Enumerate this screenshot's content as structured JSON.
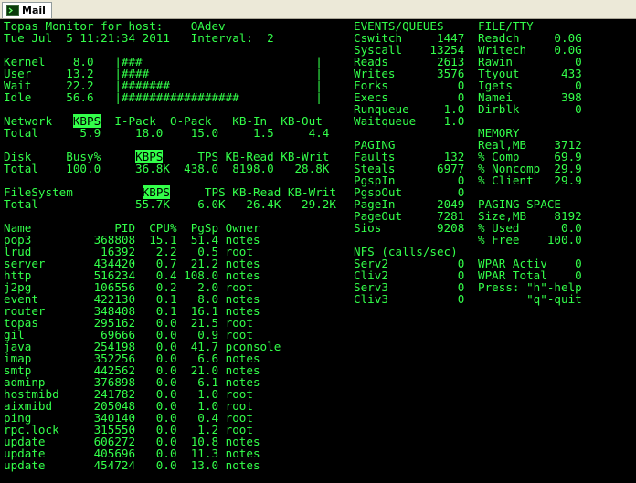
{
  "tab": {
    "label": "Mail"
  },
  "colors": {
    "background": "#000000",
    "foreground": "#33ff4a",
    "highlight_bg": "#33ff4a",
    "highlight_fg": "#000000"
  },
  "header": {
    "line1": "Topas Monitor for host:    OAdev",
    "line2": "Tue Jul  5 11:21:34 2011   Interval:  2"
  },
  "cpu": [
    "Kernel    8.0   |###                         |",
    "User     13.2   |####                        |",
    "Wait     22.2   |#######                     |",
    "Idle     56.6   |#################           |"
  ],
  "network": {
    "label": "Network",
    "kbps": "KBPS",
    "cols": "  I-Pack  O-Pack   KB-In  KB-Out",
    "total": "Total      5.9     18.0    15.0     1.5     4.4"
  },
  "disk": {
    "label": "Disk     Busy%     ",
    "kbps": "KBPS",
    "cols": "     TPS KB-Read KB-Writ",
    "total": "Total    100.0     36.8K  438.0  8198.0   28.8K"
  },
  "filesystem": {
    "label": "FileSystem          ",
    "kbps": "KBPS",
    "cols": "     TPS KB-Read KB-Writ",
    "total": "Total              55.7K    6.0K   26.4K   29.2K"
  },
  "process_header": "Name            PID  CPU%  PgSp Owner",
  "processes": [
    "pop3         368808  15.1  51.4 notes",
    "lrud          16392   2.2   0.5 root",
    "server       434420   0.7  21.2 notes",
    "http         516234   0.4 108.0 notes",
    "j2pg         106556   0.2   2.0 root",
    "event        422130   0.1   8.0 notes",
    "router       348408   0.1  16.1 notes",
    "topas        295162   0.0  21.5 root",
    "gil           69666   0.0   0.9 root",
    "java         254198   0.0  41.7 pconsole",
    "imap         352256   0.0   6.6 notes",
    "smtp         442562   0.0  21.0 notes",
    "adminp       376898   0.0   6.1 notes",
    "hostmibd     241782   0.0   1.0 root",
    "aixmibd      205048   0.0   1.0 root",
    "ping         340140   0.0   0.4 root",
    "rpc.lock     315550   0.0   1.2 root",
    "update       606272   0.0  10.8 notes",
    "update       405696   0.0  11.3 notes",
    "update       454724   0.0  13.0 notes"
  ],
  "events": [
    "EVENTS/QUEUES",
    "Cswitch     1447",
    "Syscall    13254",
    "Reads       2613",
    "Writes      3576",
    "Forks          0",
    "Execs          0",
    "Runqueue     1.0",
    "Waitqueue    1.0"
  ],
  "paging": [
    "PAGING",
    "Faults       132",
    "Steals      6977",
    "PgspIn         0",
    "PgspOut        0",
    "PageIn      2049",
    "PageOut     7281",
    "Sios        9208"
  ],
  "nfs": [
    "NFS (calls/sec)",
    "Serv2          0",
    "Cliv2          0",
    "Serv3          0",
    "Cliv3          0"
  ],
  "filetty": [
    "FILE/TTY",
    "Readch     0.0G",
    "Writech    0.0G",
    "Rawin         0",
    "Ttyout      433",
    "Igets         0",
    "Namei       398",
    "Dirblk        0"
  ],
  "memory": [
    "MEMORY",
    "Real,MB    3712",
    "% Comp     69.9",
    "% Noncomp  29.9",
    "% Client   29.9"
  ],
  "paging_space": [
    "PAGING SPACE",
    "Size,MB    8192",
    "% Used      0.0",
    "% Free    100.0"
  ],
  "wpar": [
    "WPAR Activ    0",
    "WPAR Total    0",
    "Press: \"h\"-help",
    "       \"q\"-quit"
  ]
}
